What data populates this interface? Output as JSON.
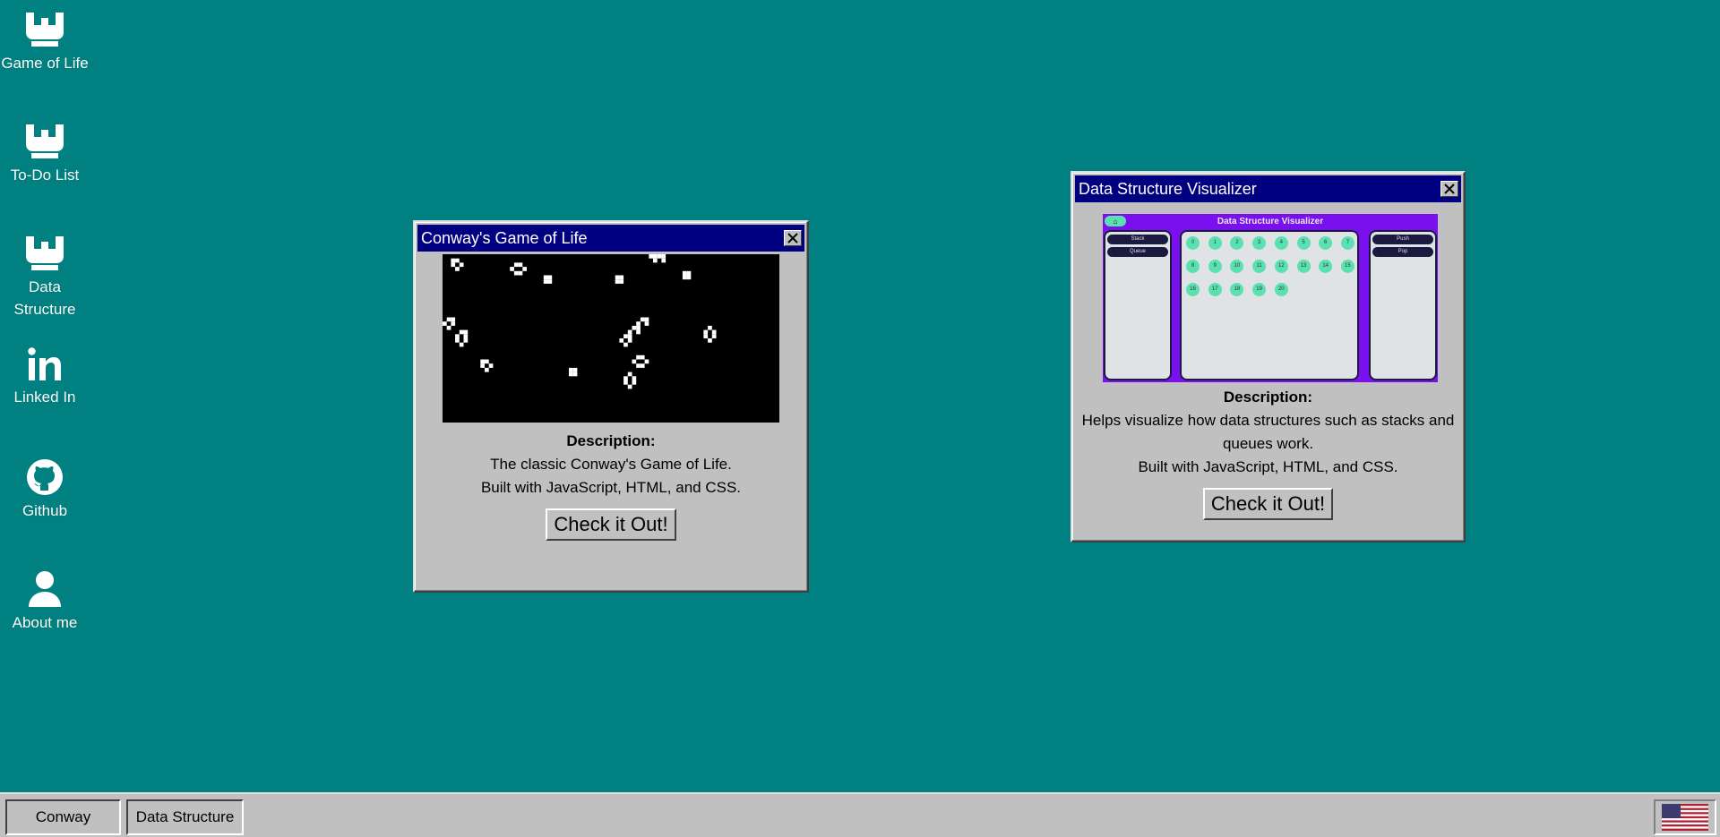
{
  "desktop_icons": [
    {
      "label": "Game of Life",
      "icon": "dropbox-icon"
    },
    {
      "label": "To-Do List",
      "icon": "dropbox-icon"
    },
    {
      "label": "Data Structure",
      "icon": "dropbox-icon"
    },
    {
      "label": "Linked In",
      "icon": "linkedin-icon"
    },
    {
      "label": "Github",
      "icon": "github-icon"
    },
    {
      "label": "About me",
      "icon": "user-icon"
    }
  ],
  "windows": {
    "conway": {
      "title": "Conway's Game of Life",
      "description_heading": "Description:",
      "description_lines": [
        "The classic Conway's Game of Life.",
        "Built with JavaScript, HTML, and CSS."
      ],
      "button_label": "Check it Out!"
    },
    "dsv": {
      "title": "Data Structure Visualizer",
      "preview": {
        "title": "Data Structure Visualizer",
        "left_buttons": [
          "Stack",
          "Queue"
        ],
        "right_buttons": [
          "Push",
          "Pop"
        ],
        "nodes": [
          "0",
          "1",
          "2",
          "3",
          "4",
          "5",
          "6",
          "7",
          "8",
          "9",
          "10",
          "11",
          "12",
          "13",
          "14",
          "15",
          "16",
          "17",
          "18",
          "19",
          "20"
        ]
      },
      "description_heading": "Description:",
      "description_lines": [
        "Helps visualize how data structures such as stacks and queues work.",
        "Built with JavaScript, HTML, and CSS."
      ],
      "button_label": "Check it Out!"
    }
  },
  "taskbar": {
    "buttons": [
      "Conway",
      "Data Structure"
    ],
    "tray_icon": "us-flag-icon"
  },
  "colors": {
    "desktop": "#008080",
    "titlebar": "#000080",
    "chrome": "#c0c0c0",
    "preview_bg": "#7a10ee",
    "preview_accent": "#5be0b0"
  }
}
